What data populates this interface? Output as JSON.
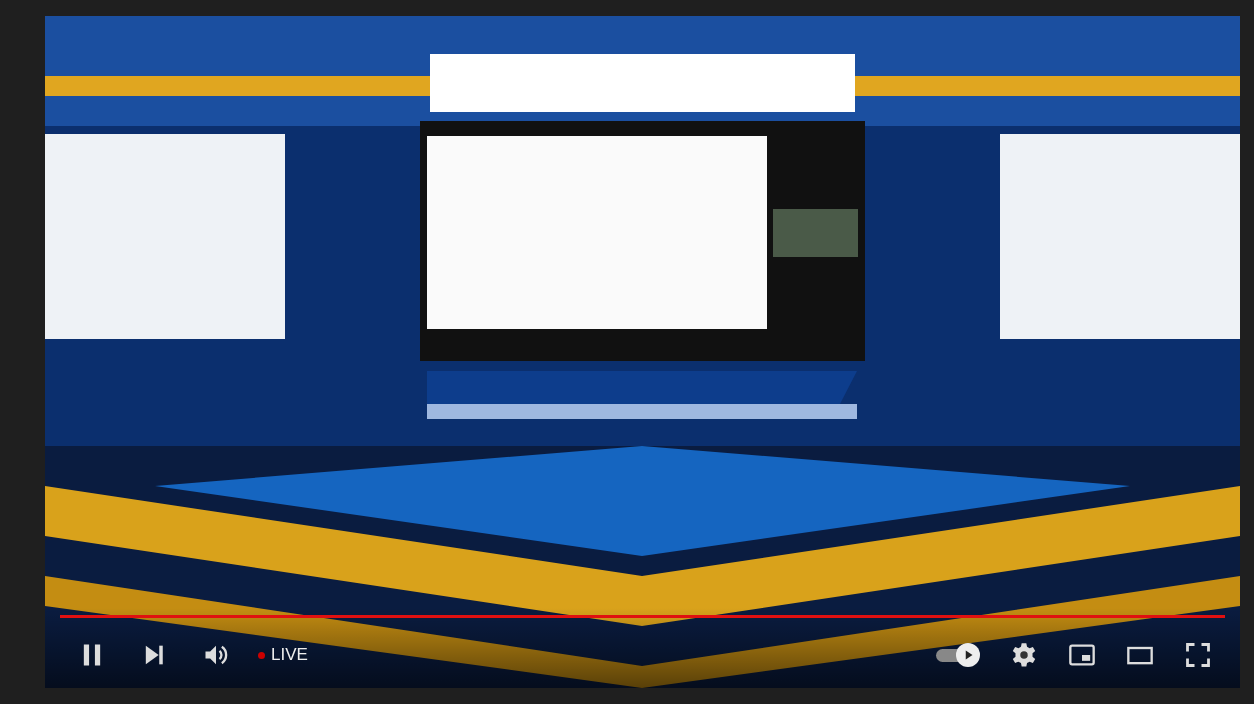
{
  "player": {
    "progress": {
      "level": 1
    },
    "live_label": "LIVE",
    "autoplay": {
      "on": true
    }
  }
}
